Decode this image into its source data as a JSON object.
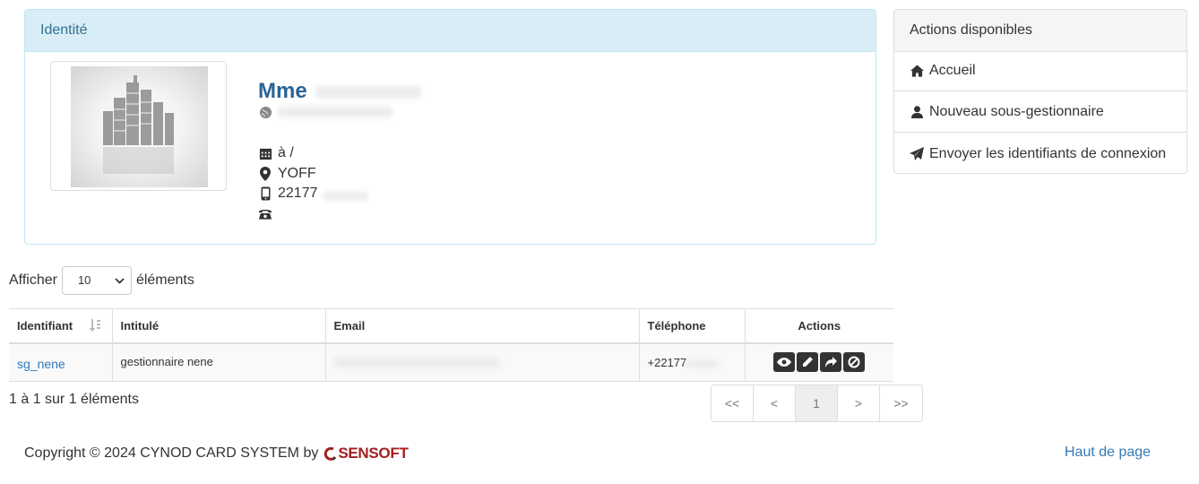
{
  "identity_panel": {
    "title": "Identité",
    "civility": "Mme",
    "birth": "à /",
    "city": "YOFF",
    "mobile": "22177"
  },
  "actions_panel": {
    "title": "Actions disponibles",
    "items": [
      {
        "label": "Accueil",
        "icon": "home-icon"
      },
      {
        "label": "Nouveau sous-gestionnaire",
        "icon": "user-icon"
      },
      {
        "label": "Envoyer les identifiants de connexion",
        "icon": "send-icon"
      }
    ]
  },
  "length_selector": {
    "prefix": "Afficher",
    "value": "10",
    "suffix": "éléments"
  },
  "table": {
    "columns": [
      "Identifiant",
      "Intitulé",
      "Email",
      "Téléphone",
      "Actions"
    ],
    "rows": [
      {
        "identifiant": "sg_nene",
        "intitule": "gestionnaire nene",
        "email": "",
        "telephone": "+22177"
      }
    ]
  },
  "table_info": "1 à 1 sur 1 éléments",
  "pagination": {
    "first": "<<",
    "prev": "<",
    "page": "1",
    "next": ">",
    "last": ">>"
  },
  "footer": {
    "copyright": "Copyright © 2024 CYNOD CARD SYSTEM by",
    "brand": "SENSOFT",
    "top_link": "Haut de page"
  },
  "colors": {
    "ident_header_bg": "#d9edf7",
    "ident_title": "#31708f",
    "link": "#337ab7",
    "name": "#2a6496",
    "brand": "#a32020"
  }
}
